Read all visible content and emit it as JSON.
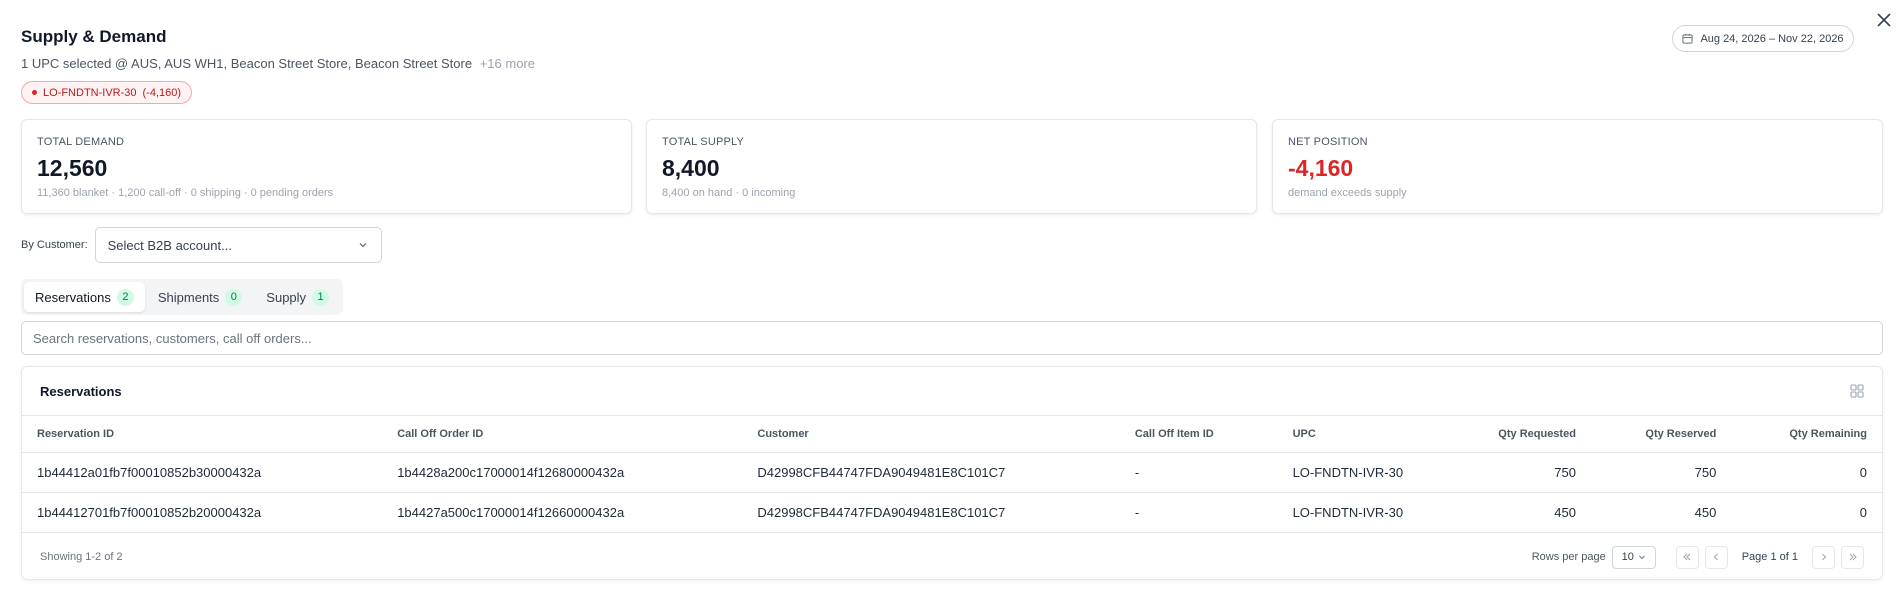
{
  "header": {
    "title": "Supply & Demand",
    "subtitle": "1 UPC selected @ AUS, AUS WH1, Beacon Street Store, Beacon Street Store",
    "more": "+16 more",
    "sku_chip": "LO-FNDTN-IVR-30",
    "sku_chip_delta": "(-4,160)"
  },
  "date_range": "Aug 24, 2026 – Nov 22, 2026",
  "cards": {
    "demand": {
      "label": "TOTAL DEMAND",
      "value": "12,560",
      "detail": "11,360 blanket · 1,200 call-off · 0 shipping · 0 pending orders"
    },
    "supply": {
      "label": "TOTAL SUPPLY",
      "value": "8,400",
      "detail": "8,400 on hand · 0 incoming"
    },
    "net": {
      "label": "NET POSITION",
      "value": "-4,160",
      "detail": "demand exceeds supply"
    }
  },
  "filter": {
    "label": "By Customer:",
    "placeholder": "Select B2B account..."
  },
  "tabs": [
    {
      "label": "Reservations",
      "count": "2"
    },
    {
      "label": "Shipments",
      "count": "0"
    },
    {
      "label": "Supply",
      "count": "1"
    }
  ],
  "search": {
    "placeholder": "Search reservations, customers, call off orders..."
  },
  "table": {
    "title": "Reservations",
    "columns": [
      "Reservation ID",
      "Call Off Order ID",
      "Customer",
      "Call Off Item ID",
      "UPC",
      "Qty Requested",
      "Qty Reserved",
      "Qty Remaining"
    ],
    "rows": [
      [
        "1b44412a01fb7f00010852b30000432a",
        "1b4428a200c17000014f12680000432a",
        "D42998CFB44747FDA9049481E8C101C7",
        "-",
        "LO-FNDTN-IVR-30",
        "750",
        "750",
        "0"
      ],
      [
        "1b44412701fb7f00010852b20000432a",
        "1b4427a500c17000014f12660000432a",
        "D42998CFB44747FDA9049481E8C101C7",
        "-",
        "LO-FNDTN-IVR-30",
        "450",
        "450",
        "0"
      ]
    ],
    "showing": "Showing 1-2 of 2",
    "rows_per_page_label": "Rows per page",
    "rows_per_page": "10",
    "page_text": "Page 1 of 1"
  },
  "colors": {
    "negative": "#dc2626",
    "badge_bg": "#d1fae5",
    "badge_text": "#047857"
  }
}
